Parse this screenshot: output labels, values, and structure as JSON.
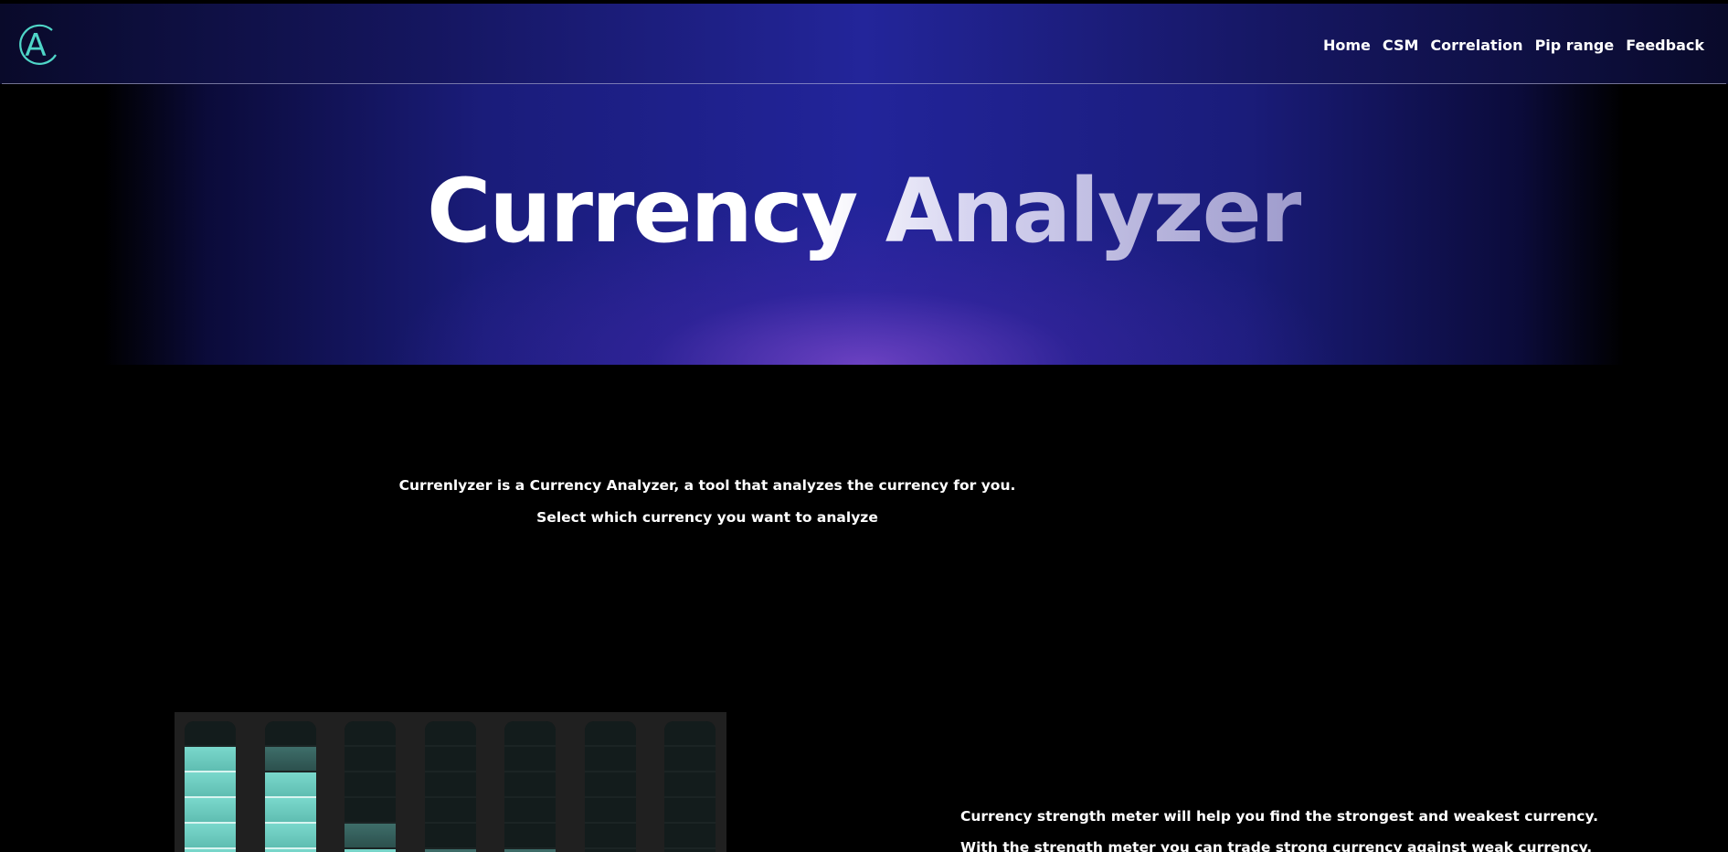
{
  "header": {
    "logo_letter": "A",
    "nav": [
      {
        "label": "Home"
      },
      {
        "label": "CSM"
      },
      {
        "label": "Correlation"
      },
      {
        "label": "Pip range"
      },
      {
        "label": "Feedback"
      }
    ]
  },
  "hero": {
    "title": "Currency Analyzer"
  },
  "intro": {
    "line1": "Currenlyzer is a Currency Analyzer, a tool that analyzes the currency for you.",
    "line2": "Select which currency you want to analyze"
  },
  "strength_meter": {
    "accent": "#6fcfc3",
    "bars": [
      {
        "level": 5
      },
      {
        "level": 4,
        "partial": 1
      },
      {
        "level": 1,
        "partial": 1
      },
      {
        "level": 0,
        "partial": 1
      },
      {
        "level": 0,
        "partial": 1
      },
      {
        "level": 0
      },
      {
        "level": 0
      }
    ]
  },
  "csm": {
    "line1": "Currency strength meter will help you find the strongest and weakest currency.",
    "line2": "With the strength meter you can trade strong currency against weak currency."
  },
  "colors": {
    "hero_blue": "#22249a",
    "hero_glow": "#7846c8",
    "logo": "#4fd6c8"
  }
}
